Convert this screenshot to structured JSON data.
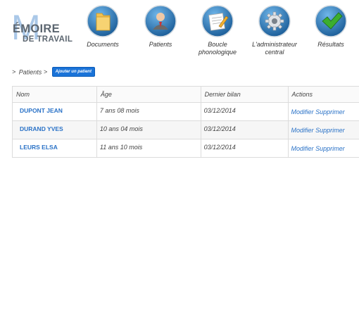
{
  "logo": {
    "big_letter": "M",
    "line1": "ÉMOIRE",
    "line2": "DE TRAVAIL"
  },
  "nav": {
    "items": [
      {
        "label": "Documents",
        "icon": "folder-icon"
      },
      {
        "label": "Patients",
        "icon": "user-icon"
      },
      {
        "label": "Boucle phonologique",
        "icon": "notepad-pencil-icon"
      },
      {
        "label": "L'administrateur central",
        "icon": "gear-icon"
      },
      {
        "label": "Résultats",
        "icon": "checkmark-icon"
      }
    ]
  },
  "breadcrumb": {
    "separator": ">",
    "current": "Patients",
    "add_button": "Ajouter un patient"
  },
  "table": {
    "headers": [
      "Nom",
      "Âge",
      "Dernier bilan",
      "Actions"
    ],
    "rows": [
      {
        "name": "DUPONT JEAN",
        "age": "7 ans 08 mois",
        "last": "03/12/2014",
        "edit": "Modifier",
        "delete": "Supprimer"
      },
      {
        "name": "DURAND YVES",
        "age": "10 ans 04 mois",
        "last": "03/12/2014",
        "edit": "Modifier",
        "delete": "Supprimer"
      },
      {
        "name": "LEURS ELSA",
        "age": "11 ans 10 mois",
        "last": "03/12/2014",
        "edit": "Modifier",
        "delete": "Supprimer"
      }
    ]
  },
  "colors": {
    "accent": "#2a72c7",
    "button": "#1a73d8",
    "icon_blue": "#2f7fc1"
  }
}
